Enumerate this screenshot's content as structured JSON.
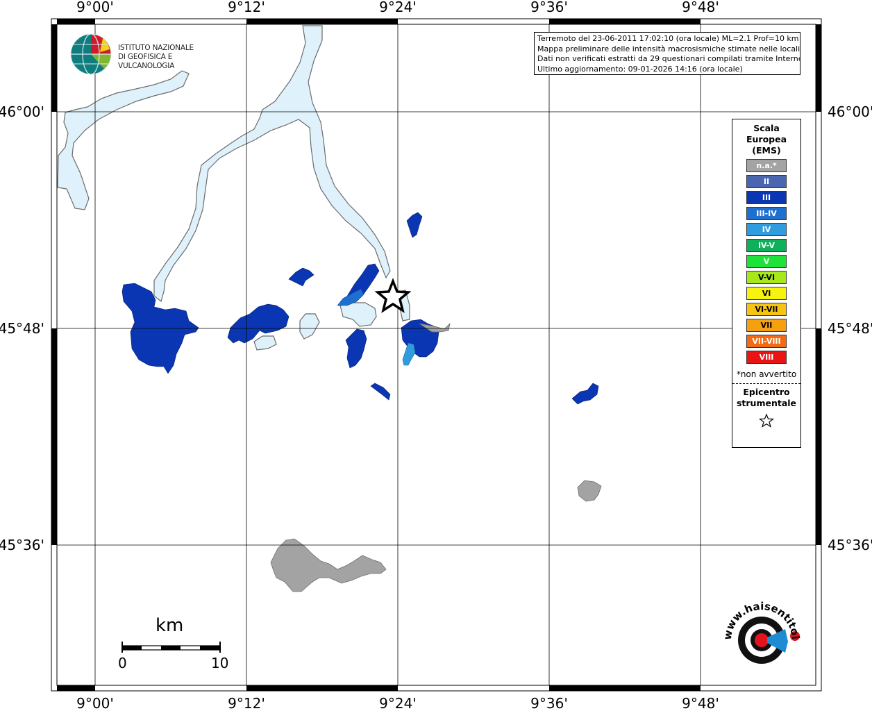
{
  "map": {
    "lon_labels": [
      "9°00'",
      "9°12'",
      "9°24'",
      "9°36'",
      "9°48'"
    ],
    "lat_labels": [
      "46°00'",
      "45°48'",
      "45°36'"
    ]
  },
  "info": {
    "line1": "Terremoto del 23-06-2011 17:02:10 (ora locale) ML=2.1 Prof=10 km",
    "line2": "Mappa preliminare delle intensità macrosismiche stimate nelle località",
    "line3": "Dati non verificati estratti da 29 questionari compilati tramite Internet.",
    "line4": "Ultimo aggiornamento: 09-01-2026 14:16 (ora locale)"
  },
  "legend": {
    "title": "Scala Europea (EMS)",
    "items": [
      {
        "label": "n.a.*",
        "color": "#a3a3a3"
      },
      {
        "label": "II",
        "color": "#4a66b0"
      },
      {
        "label": "III",
        "color": "#0a36b4"
      },
      {
        "label": "III-IV",
        "color": "#1f6fd1"
      },
      {
        "label": "IV",
        "color": "#2f9ce0"
      },
      {
        "label": "IV-V",
        "color": "#0fb05a"
      },
      {
        "label": "V",
        "color": "#1ee13a"
      },
      {
        "label": "V-VI",
        "color": "#a6e81a"
      },
      {
        "label": "VI",
        "color": "#f6f30f"
      },
      {
        "label": "VI-VII",
        "color": "#f7c412"
      },
      {
        "label": "VII",
        "color": "#f5a00f"
      },
      {
        "label": "VII-VIII",
        "color": "#f26a14"
      },
      {
        "label": "VIII",
        "color": "#ea1414"
      }
    ],
    "note": "*non avvertito",
    "epicenter": "Epicentro strumentale"
  },
  "scale": {
    "unit": "km",
    "min": "0",
    "max": "10"
  },
  "logos": {
    "ingv_line1": "ISTITUTO NAZIONALE",
    "ingv_line2": "DI GEOFISICA E VULCANOLOGIA",
    "hai_text": "www.haisentitoilterremoto.it"
  }
}
